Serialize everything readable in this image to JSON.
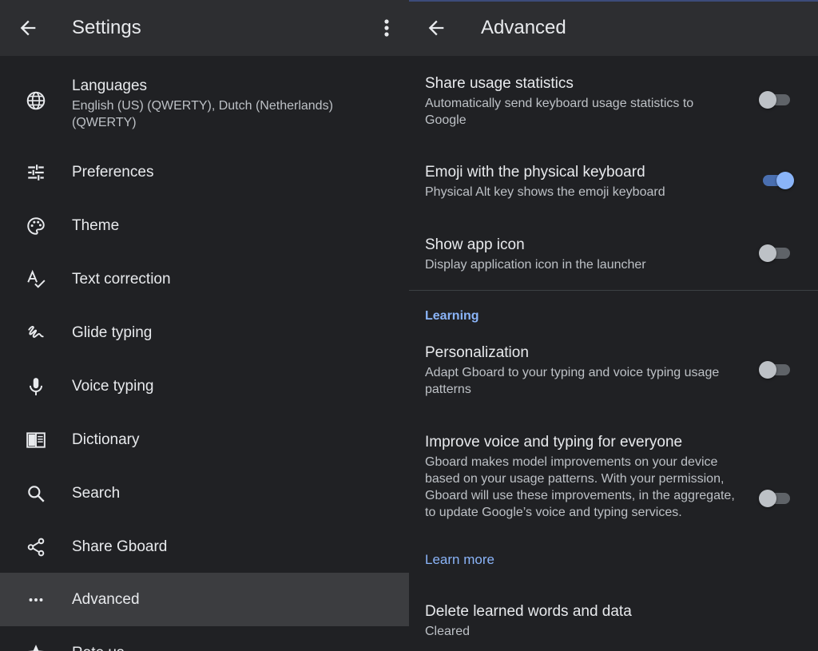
{
  "left": {
    "title": "Settings",
    "items": [
      {
        "label": "Languages",
        "sub": "English (US) (QWERTY), Dutch (Netherlands) (QWERTY)",
        "icon": "globe-icon"
      },
      {
        "label": "Preferences",
        "icon": "sliders-icon"
      },
      {
        "label": "Theme",
        "icon": "palette-icon"
      },
      {
        "label": "Text correction",
        "icon": "spellcheck-icon"
      },
      {
        "label": "Glide typing",
        "icon": "gesture-icon"
      },
      {
        "label": "Voice typing",
        "icon": "microphone-icon"
      },
      {
        "label": "Dictionary",
        "icon": "book-icon"
      },
      {
        "label": "Search",
        "icon": "search-icon"
      },
      {
        "label": "Share Gboard",
        "icon": "share-icon"
      },
      {
        "label": "Advanced",
        "icon": "more-horiz-icon",
        "selected": true
      },
      {
        "label": "Rate us",
        "icon": "star-icon"
      }
    ]
  },
  "right": {
    "title": "Advanced",
    "settings": [
      {
        "title": "Share usage statistics",
        "sub": "Automatically send keyboard usage statistics to Google",
        "enabled": false
      },
      {
        "title": "Emoji with the physical keyboard",
        "sub": "Physical Alt key shows the emoji keyboard",
        "enabled": true
      },
      {
        "title": "Show app icon",
        "sub": "Display application icon in the launcher",
        "enabled": false
      }
    ],
    "section_learning": "Learning",
    "learning": [
      {
        "title": "Personalization",
        "sub": "Adapt Gboard to your typing and voice typing usage patterns",
        "enabled": false
      },
      {
        "title": "Improve voice and typing for everyone",
        "sub": "Gboard makes model improvements on your device based on your usage patterns. With your permission, Gboard will use these improvements, in the aggregate, to update Google’s voice and typing services.",
        "enabled": false,
        "link": "Learn more"
      }
    ],
    "delete": {
      "title": "Delete learned words and data",
      "sub": "Cleared"
    }
  },
  "colors": {
    "background": "#202124",
    "appbar": "#2d2e31",
    "accent": "#8ab4f8",
    "selected": "#3c3d40"
  }
}
